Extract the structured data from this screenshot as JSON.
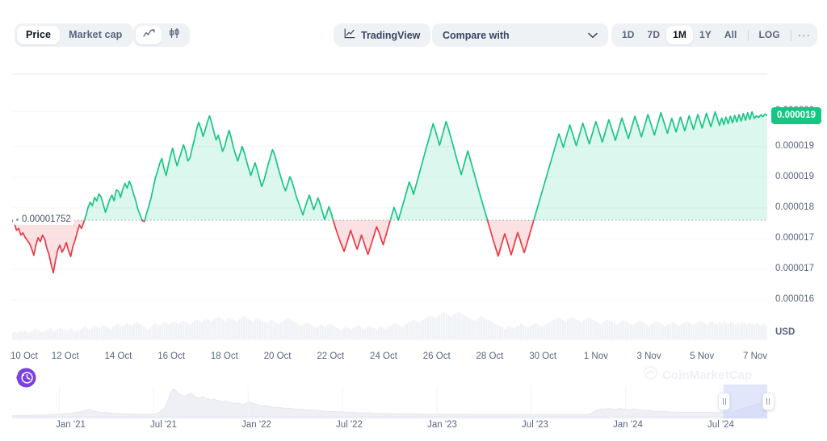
{
  "toolbar": {
    "type_toggle": [
      {
        "label": "Price",
        "active": true
      },
      {
        "label": "Market cap",
        "active": false
      }
    ],
    "style_toggle": [
      {
        "icon": "line-chart-icon",
        "active": true
      },
      {
        "icon": "candlestick-chart-icon",
        "active": false
      }
    ],
    "tradingview": {
      "label": "TradingView",
      "icon": "tradingview-icon"
    },
    "compare": {
      "label": "Compare with",
      "icon": "chevron-down-icon"
    },
    "ranges": [
      {
        "label": "1D",
        "active": false
      },
      {
        "label": "7D",
        "active": false
      },
      {
        "label": "1M",
        "active": true
      },
      {
        "label": "1Y",
        "active": false
      },
      {
        "label": "All",
        "active": false
      }
    ],
    "log_label": "LOG",
    "more_label": "···"
  },
  "chart_data": {
    "type": "area",
    "title": "",
    "xlabel": "",
    "ylabel": "USD",
    "currency_label": "USD",
    "grid": true,
    "legend_position": "none",
    "current_price_label": "0.000019",
    "reference_price_label": "0.00001752",
    "reference_price_value": 1.752e-05,
    "ylim": [
      1.55e-05,
      2.05e-05
    ],
    "yticks": [
      {
        "label": "0.000020",
        "value": 2e-05
      },
      {
        "label": "0.000019",
        "value": 1.92e-05
      },
      {
        "label": "0.000019",
        "value": 1.85e-05
      },
      {
        "label": "0.000018",
        "value": 1.78e-05
      },
      {
        "label": "0.000017",
        "value": 1.71e-05
      },
      {
        "label": "0.000017",
        "value": 1.64e-05
      },
      {
        "label": "0.000016",
        "value": 1.57e-05
      }
    ],
    "xticks": [
      "10 Oct",
      "12 Oct",
      "14 Oct",
      "16 Oct",
      "18 Oct",
      "20 Oct",
      "22 Oct",
      "24 Oct",
      "26 Oct",
      "28 Oct",
      "30 Oct",
      "1 Nov",
      "3 Nov",
      "5 Nov",
      "7 Nov"
    ],
    "colors": {
      "up": "#16c784",
      "down": "#ea3943",
      "up_fill": "#16c78426",
      "down_fill": "#ea394326",
      "grid": "#f3f5f8",
      "axis_text": "#58667e",
      "volume": "#eff2f6",
      "accent_purple": "#7b3fe4"
    },
    "price_series": [
      17520,
      17460,
      17290,
      17330,
      17180,
      17230,
      17130,
      17060,
      16990,
      16870,
      16720,
      16960,
      17120,
      17030,
      17180,
      17090,
      16880,
      16740,
      16510,
      16320,
      16600,
      16840,
      16950,
      16790,
      16880,
      17010,
      16820,
      16690,
      16920,
      17060,
      17240,
      17410,
      17330,
      17470,
      17620,
      17810,
      17930,
      17850,
      18040,
      17960,
      18120,
      18050,
      17880,
      17700,
      17840,
      18000,
      18090,
      17960,
      18210,
      18180,
      18040,
      18230,
      18360,
      18250,
      18410,
      18290,
      18120,
      17960,
      17760,
      17640,
      17510,
      17490,
      17680,
      17840,
      18020,
      18250,
      18480,
      18630,
      18810,
      18930,
      18700,
      18540,
      18780,
      18990,
      19160,
      18940,
      18760,
      18920,
      19080,
      19240,
      19090,
      18870,
      18940,
      19170,
      19360,
      19590,
      19750,
      19610,
      19430,
      19580,
      19760,
      19900,
      19740,
      19530,
      19350,
      19460,
      19280,
      19090,
      19210,
      19400,
      19570,
      19390,
      19180,
      19010,
      18870,
      19030,
      19200,
      19060,
      18880,
      18700,
      18540,
      18690,
      18830,
      18660,
      18470,
      18290,
      18420,
      18600,
      18790,
      18960,
      19130,
      19010,
      18830,
      18640,
      18480,
      18310,
      18190,
      18340,
      18510,
      18400,
      18230,
      18060,
      17920,
      17780,
      17640,
      17810,
      17960,
      18090,
      17920,
      17760,
      17890,
      18030,
      17880,
      17710,
      17540,
      17670,
      17830,
      17690,
      17520,
      17350,
      17200,
      17060,
      16930,
      16810,
      16960,
      17120,
      17290,
      17140,
      16990,
      16860,
      17010,
      17180,
      17030,
      16880,
      16740,
      16890,
      17050,
      17210,
      17370,
      17250,
      17100,
      16960,
      17130,
      17300,
      17470,
      17640,
      17810,
      17680,
      17520,
      17690,
      17860,
      18030,
      18210,
      18390,
      18270,
      18110,
      18290,
      18470,
      18650,
      18830,
      19010,
      19190,
      19360,
      19540,
      19720,
      19580,
      19400,
      19230,
      19410,
      19590,
      19770,
      19620,
      19440,
      19260,
      19080,
      18900,
      18730,
      18560,
      18740,
      18920,
      19100,
      18930,
      18750,
      18570,
      18390,
      18210,
      18040,
      17870,
      17700,
      17530,
      17360,
      17190,
      17020,
      16860,
      16700,
      16870,
      17040,
      17210,
      17060,
      16890,
      16730,
      16900,
      17070,
      17240,
      17090,
      16930,
      16780,
      16940,
      17110,
      17280,
      17450,
      17620,
      17790,
      17960,
      18130,
      18300,
      18470,
      18640,
      18810,
      18980,
      19150,
      19320,
      19490,
      19340,
      19180,
      19350,
      19520,
      19690,
      19540,
      19380,
      19220,
      19390,
      19560,
      19730,
      19580,
      19420,
      19260,
      19430,
      19600,
      19770,
      19620,
      19460,
      19300,
      19470,
      19640,
      19810,
      19660,
      19500,
      19340,
      19510,
      19680,
      19850,
      19700,
      19540,
      19380,
      19550,
      19720,
      19890,
      19740,
      19580,
      19420,
      19590,
      19760,
      19930,
      19780,
      19620,
      19460,
      19630,
      19800,
      19970,
      19820,
      19660,
      19500,
      19670,
      19840,
      19690,
      19530,
      19700,
      19870,
      19720,
      19560,
      19730,
      19900,
      19750,
      19590,
      19760,
      19930,
      19780,
      19620,
      19790,
      19960,
      19810,
      19650,
      19820,
      19990,
      19840,
      19680,
      19850,
      19700,
      19870,
      19720,
      19890,
      19740,
      19910,
      19760,
      19930,
      19780,
      19950,
      19800,
      19970,
      19820,
      19990,
      19840,
      19900,
      19860,
      19920,
      19880,
      19940,
      19900
    ],
    "volume_series": [
      22,
      25,
      20,
      28,
      24,
      30,
      26,
      22,
      27,
      31,
      35,
      29,
      26,
      24,
      28,
      32,
      36,
      30,
      27,
      33,
      38,
      34,
      30,
      27,
      31,
      35,
      29,
      26,
      30,
      34,
      38,
      42,
      36,
      32,
      38,
      44,
      40,
      36,
      42,
      46,
      42,
      38,
      34,
      40,
      46,
      50,
      46,
      42,
      48,
      52,
      48,
      44,
      50,
      54,
      50,
      46,
      42,
      38,
      34,
      40,
      46,
      52,
      48,
      44,
      50,
      56,
      52,
      48,
      54,
      58,
      54,
      50,
      56,
      60,
      56,
      52,
      48,
      54,
      60,
      64,
      60,
      56,
      62,
      66,
      62,
      58,
      64,
      68,
      72,
      68,
      64,
      60,
      66,
      70,
      66,
      62,
      58,
      64,
      70,
      74,
      70,
      66,
      62,
      58,
      64,
      68,
      64,
      60,
      56,
      52,
      58,
      62,
      58,
      54,
      50,
      56,
      60,
      64,
      68,
      64,
      60,
      56,
      52,
      48,
      44,
      50,
      54,
      50,
      46,
      42,
      38,
      44,
      48,
      44,
      40,
      46,
      50,
      46,
      42,
      38,
      34,
      30,
      36,
      40,
      36,
      32,
      38,
      42,
      46,
      42,
      38,
      34,
      40,
      44,
      40,
      36,
      32,
      38,
      42,
      38,
      34,
      40,
      44,
      48,
      52,
      48,
      44,
      40,
      46,
      50,
      54,
      58,
      62,
      58,
      54,
      60,
      64,
      68,
      72,
      76,
      72,
      68,
      74,
      78,
      82,
      86,
      82,
      78,
      74,
      80,
      84,
      88,
      84,
      80,
      76,
      72,
      68,
      64,
      60,
      66,
      70,
      74,
      70,
      66,
      62,
      58,
      54,
      50,
      46,
      42,
      38,
      34,
      40,
      44,
      40,
      36,
      42,
      46,
      50,
      46,
      42,
      38,
      44,
      48,
      52,
      48,
      44,
      40,
      46,
      50,
      54,
      58,
      62,
      66,
      70,
      66,
      62,
      58,
      64,
      68,
      72,
      68,
      64,
      60,
      56,
      62,
      66,
      70,
      66,
      62,
      58,
      54,
      50,
      56,
      60,
      64,
      60,
      56,
      52,
      48,
      54,
      58,
      62,
      58,
      54,
      50,
      46,
      52,
      56,
      60,
      56,
      52,
      48,
      44,
      50,
      54,
      58,
      54,
      50,
      46,
      42,
      48,
      52,
      56,
      52,
      48,
      44,
      50,
      54,
      58,
      54,
      50,
      46,
      52,
      56,
      60,
      56,
      52,
      48,
      54,
      58,
      54,
      50,
      56,
      52,
      58,
      54,
      50,
      56,
      52,
      48,
      54,
      50,
      56,
      52,
      48,
      54,
      50,
      46,
      52,
      48,
      44,
      50,
      46
    ]
  },
  "navigator": {
    "xticks": [
      "Jan '21",
      "Jul '21",
      "Jan '22",
      "Jul '22",
      "Jan '23",
      "Jul '23",
      "Jan '24",
      "Jul '24"
    ],
    "selection": {
      "left_pct": 94.2,
      "right_pct": 100
    },
    "overview_series": [
      1,
      1,
      1,
      1,
      1,
      1,
      1,
      1,
      2,
      2,
      2,
      2,
      3,
      3,
      3,
      4,
      4,
      5,
      5,
      6,
      6,
      7,
      8,
      9,
      10,
      12,
      14,
      16,
      12,
      10,
      9,
      8,
      8,
      7,
      7,
      6,
      6,
      6,
      5,
      5,
      5,
      5,
      5,
      4,
      4,
      4,
      4,
      4,
      4,
      5,
      6,
      8,
      12,
      20,
      34,
      52,
      62,
      56,
      50,
      46,
      44,
      48,
      52,
      46,
      42,
      40,
      44,
      40,
      38,
      36,
      38,
      36,
      34,
      32,
      34,
      32,
      30,
      28,
      30,
      28,
      26,
      28,
      32,
      30,
      28,
      26,
      24,
      22,
      24,
      22,
      20,
      19,
      20,
      19,
      18,
      17,
      18,
      17,
      16,
      15,
      16,
      15,
      14,
      13,
      14,
      13,
      12,
      12,
      11,
      11,
      10,
      10,
      10,
      9,
      9,
      9,
      8,
      8,
      8,
      8,
      7,
      7,
      7,
      7,
      7,
      6,
      6,
      6,
      6,
      6,
      6,
      6,
      5,
      5,
      5,
      5,
      5,
      5,
      5,
      5,
      5,
      4,
      4,
      4,
      4,
      4,
      4,
      4,
      4,
      4,
      4,
      4,
      4,
      4,
      4,
      4,
      4,
      4,
      4,
      3,
      3,
      3,
      3,
      3,
      3,
      3,
      3,
      3,
      3,
      3,
      3,
      3,
      3,
      3,
      3,
      3,
      3,
      3,
      3,
      3,
      3,
      3,
      3,
      3,
      3,
      3,
      3,
      3,
      3,
      3,
      3,
      3,
      3,
      3,
      3,
      3,
      3,
      3,
      3,
      3,
      4,
      6,
      10,
      14,
      16,
      15,
      16,
      17,
      16,
      15,
      16,
      17,
      16,
      15,
      14,
      15,
      16,
      15,
      14,
      13,
      12,
      13,
      12,
      11,
      11,
      10,
      10,
      10,
      9,
      9,
      9,
      9,
      8,
      8,
      8,
      8,
      8,
      8,
      8,
      8,
      8,
      8,
      8,
      8,
      8,
      8,
      8,
      8,
      8,
      9,
      10,
      12,
      14,
      16,
      18,
      20,
      22,
      24,
      26,
      28,
      30,
      32,
      34
    ]
  },
  "history_button": {
    "icon": "history-clock-icon",
    "color": "#7b3fe4"
  },
  "watermark": {
    "text": "CoinMarketCap",
    "icon": "coinmarketcap-logo-icon"
  }
}
